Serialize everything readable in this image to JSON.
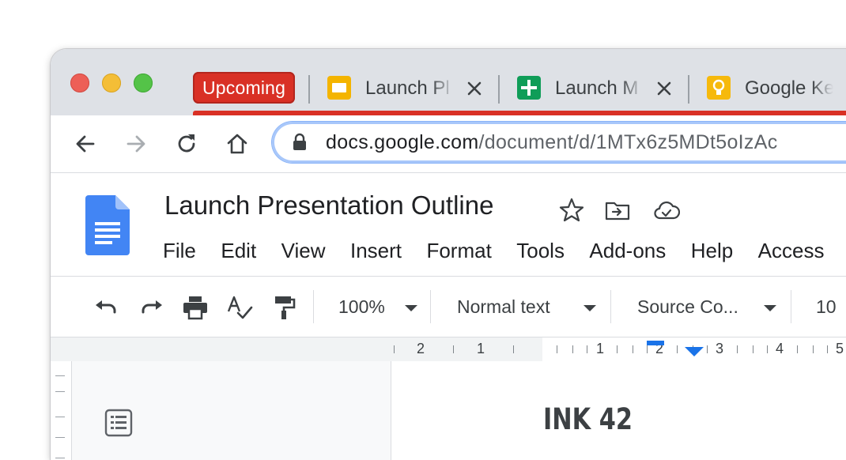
{
  "browser": {
    "tab_group": {
      "label": "Upcoming",
      "color": "#d93025"
    },
    "tabs": [
      {
        "title": "Launch Pl",
        "favicon": "google-slides-icon"
      },
      {
        "title": "Launch M",
        "favicon": "google-sheets-icon"
      },
      {
        "title": "Google Ke",
        "favicon": "google-keep-icon"
      }
    ],
    "url": {
      "host": "docs.google.com",
      "path": "/document/d/1MTx6z5MDt5oIzAc"
    }
  },
  "docs": {
    "title": "Launch Presentation Outline",
    "menu": [
      "File",
      "Edit",
      "View",
      "Insert",
      "Format",
      "Tools",
      "Add-ons",
      "Help",
      "Access"
    ],
    "toolbar": {
      "zoom": "100%",
      "style": "Normal text",
      "font": "Source Co...",
      "font_size": "10"
    },
    "ruler": {
      "left_numbers": [
        "2",
        "1"
      ],
      "right_numbers": [
        "1",
        "2",
        "3",
        "4",
        "5"
      ]
    },
    "page": {
      "heading": "INK 42"
    }
  },
  "colors": {
    "tabstrip": "#dee1e6",
    "accent_blue": "#1a73e8",
    "group_red": "#d93025"
  }
}
